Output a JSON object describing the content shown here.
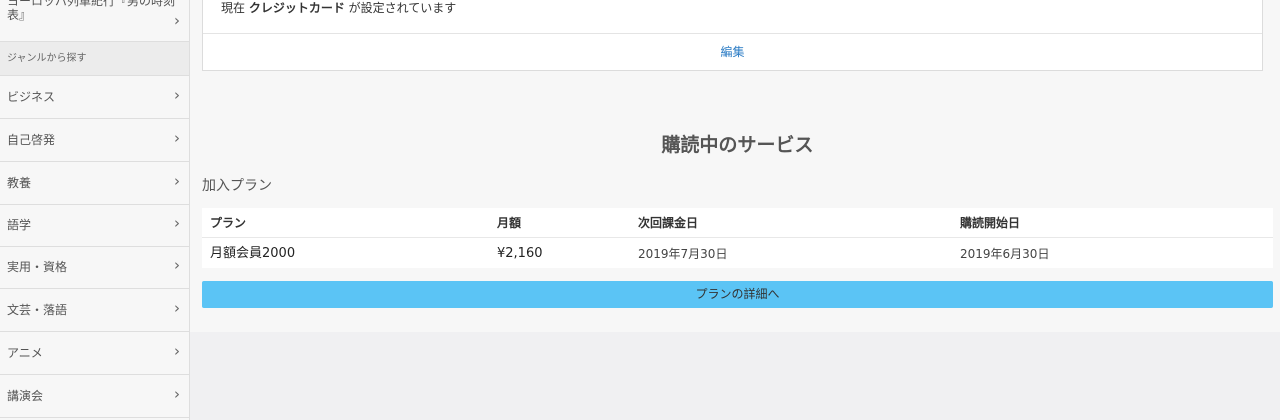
{
  "sidebar": {
    "top_item": {
      "label": "ヨーロッパ列車紀行『男の時刻表』"
    },
    "section_label": "ジャンルから探す",
    "genres": [
      {
        "label": "ビジネス"
      },
      {
        "label": "自己啓発"
      },
      {
        "label": "教養"
      },
      {
        "label": "語学"
      },
      {
        "label": "実用・資格"
      },
      {
        "label": "文芸・落語"
      },
      {
        "label": "アニメ"
      },
      {
        "label": "講演会"
      }
    ],
    "chevron_glyph": "›"
  },
  "payment": {
    "prefix": "現在 ",
    "method": "クレジットカード",
    "suffix": " が設定されています",
    "edit_label": "編集"
  },
  "subscriptions": {
    "title": "購読中のサービス",
    "plan_label": "加入プラン",
    "columns": [
      "プラン",
      "月額",
      "次回課金日",
      "購読開始日"
    ],
    "rows": [
      {
        "plan": "月額会員2000",
        "price": "¥2,160",
        "next_billing": "2019年7月30日",
        "start_date": "2019年6月30日"
      }
    ],
    "detail_button": "プランの詳細へ"
  },
  "colors": {
    "accent_button": "#5bc4f5",
    "link": "#2a7bc4"
  }
}
